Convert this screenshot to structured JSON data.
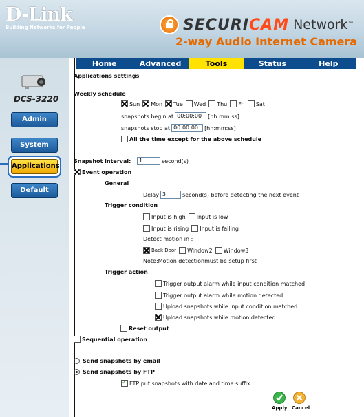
{
  "header": {
    "brand": "D-Link",
    "tagline": "Building Networks for People",
    "title_securi": "SECURI",
    "title_cam": "CAM",
    "title_network": "Network",
    "title_tm": "™",
    "subtitle": "2-way Audio Internet Camera"
  },
  "sidebar": {
    "model": "DCS-3220",
    "buttons": [
      "Admin",
      "System",
      "Applications",
      "Default"
    ]
  },
  "tabs": [
    "Home",
    "Advanced",
    "Tools",
    "Status",
    "Help"
  ],
  "page": {
    "title": "Applications settings",
    "weekly_schedule": "Weekly schedule",
    "days": [
      "Sun",
      "Mon",
      "Tue",
      "Wed",
      "Thu",
      "Fri",
      "Sat"
    ],
    "begin_label": "snapshots begin at",
    "begin_value": "00:00:00",
    "stop_label": "snapshots stop at",
    "stop_value": "00:00:00",
    "time_hint": "[hh:mm:ss]",
    "all_time": "All the time except for the above schedule",
    "interval_label": "Snapshot interval:",
    "interval_value": "1",
    "interval_unit": "second(s)",
    "event_operation": "Event operation",
    "general": "General",
    "delay_label": "Delay",
    "delay_value": "3",
    "delay_suffix": "second(s) before detecting the next event",
    "trigger_condition": "Trigger condition",
    "input_high": "Input is high",
    "input_low": "Input is low",
    "input_rising": "Input is rising",
    "input_falling": "Input is falling",
    "detect_motion": "Detect motion in :",
    "windows": [
      "Back Door",
      "Window2",
      "Window3"
    ],
    "note_prefix": "Note: ",
    "note_link": "Motion detection",
    "note_suffix": " must be setup first",
    "trigger_action": "Trigger action",
    "action1": "Trigger output alarm while input condition matched",
    "action2": "Trigger output alarm while motion detected",
    "action3": "Upload snapshots while input condition matched",
    "action4": "Upload snapshots while motion detected",
    "reset_output": "Reset output",
    "sequential": "Sequential operation",
    "send_email": "Send snapshots by email",
    "send_ftp": "Send snapshots by FTP",
    "ftp_suffix": "FTP put snapshots with date and time suffix",
    "apply": "Apply",
    "cancel": "Cancel"
  }
}
